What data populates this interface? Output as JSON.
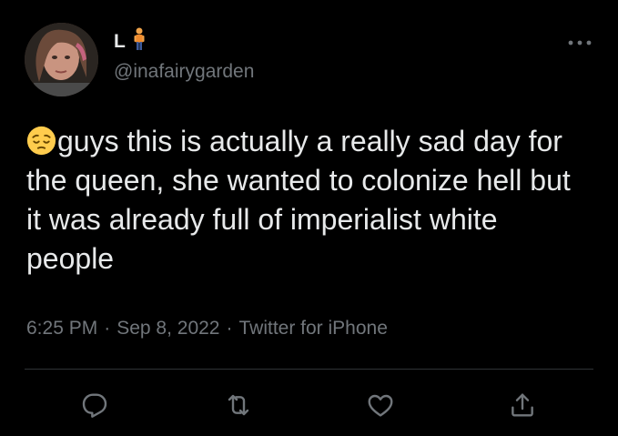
{
  "author": {
    "display_name": "L",
    "display_name_icon": "person-standing-emoji",
    "handle": "@inafairygarden",
    "avatar": "profile-photo"
  },
  "tweet": {
    "leading_emoji": "pensive-face-emoji",
    "text": "guys this is actually a really sad day for the queen, she wanted to colonize hell but it was already full of imperialist white people"
  },
  "meta": {
    "time": "6:25 PM",
    "separator": "·",
    "date": "Sep 8, 2022",
    "source": "Twitter for iPhone"
  },
  "actions": [
    {
      "name": "reply",
      "icon": "reply-bubble-icon"
    },
    {
      "name": "retweet",
      "icon": "retweet-icon"
    },
    {
      "name": "like",
      "icon": "heart-icon"
    },
    {
      "name": "share",
      "icon": "share-icon"
    }
  ],
  "colors": {
    "background": "#000000",
    "primary_text": "#e7e9ea",
    "secondary_text": "#71767b",
    "divider": "#2f3336"
  }
}
